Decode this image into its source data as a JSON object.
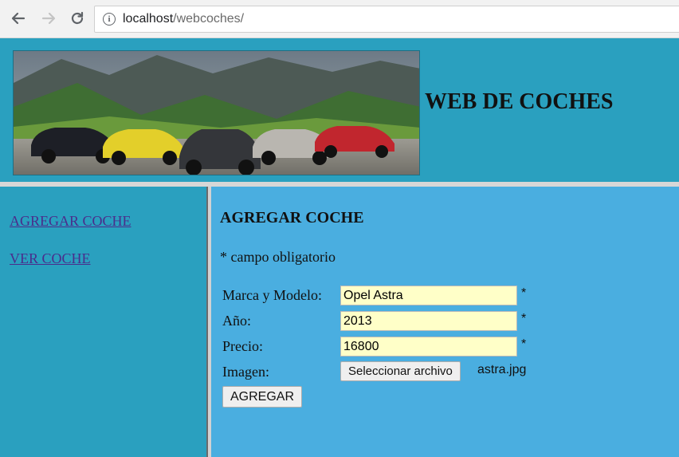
{
  "browser": {
    "url_host": "localhost",
    "url_path": "/webcoches/"
  },
  "header": {
    "title": "WEB DE COCHES"
  },
  "sidebar": {
    "items": [
      {
        "label": "AGREGAR COCHE "
      },
      {
        "label": "VER COCHE"
      }
    ]
  },
  "main": {
    "heading": "AGREGAR COCHE",
    "required_note": "* campo obligatorio",
    "form": {
      "fields": [
        {
          "label": "Marca y Modelo:",
          "value": "Opel Astra",
          "required_mark": "*"
        },
        {
          "label": "Año:",
          "value": "2013",
          "required_mark": "*"
        },
        {
          "label": "Precio:",
          "value": "16800",
          "required_mark": "*"
        }
      ],
      "image_label": "Imagen:",
      "file_button_label": "Seleccionar archivo",
      "file_name": "astra.jpg",
      "submit_label": "AGREGAR"
    }
  },
  "colors": {
    "header_bg": "#2aa0bf",
    "content_bg": "#4aaee0",
    "input_bg": "#ffffc8",
    "link": "#4a2d8c"
  }
}
